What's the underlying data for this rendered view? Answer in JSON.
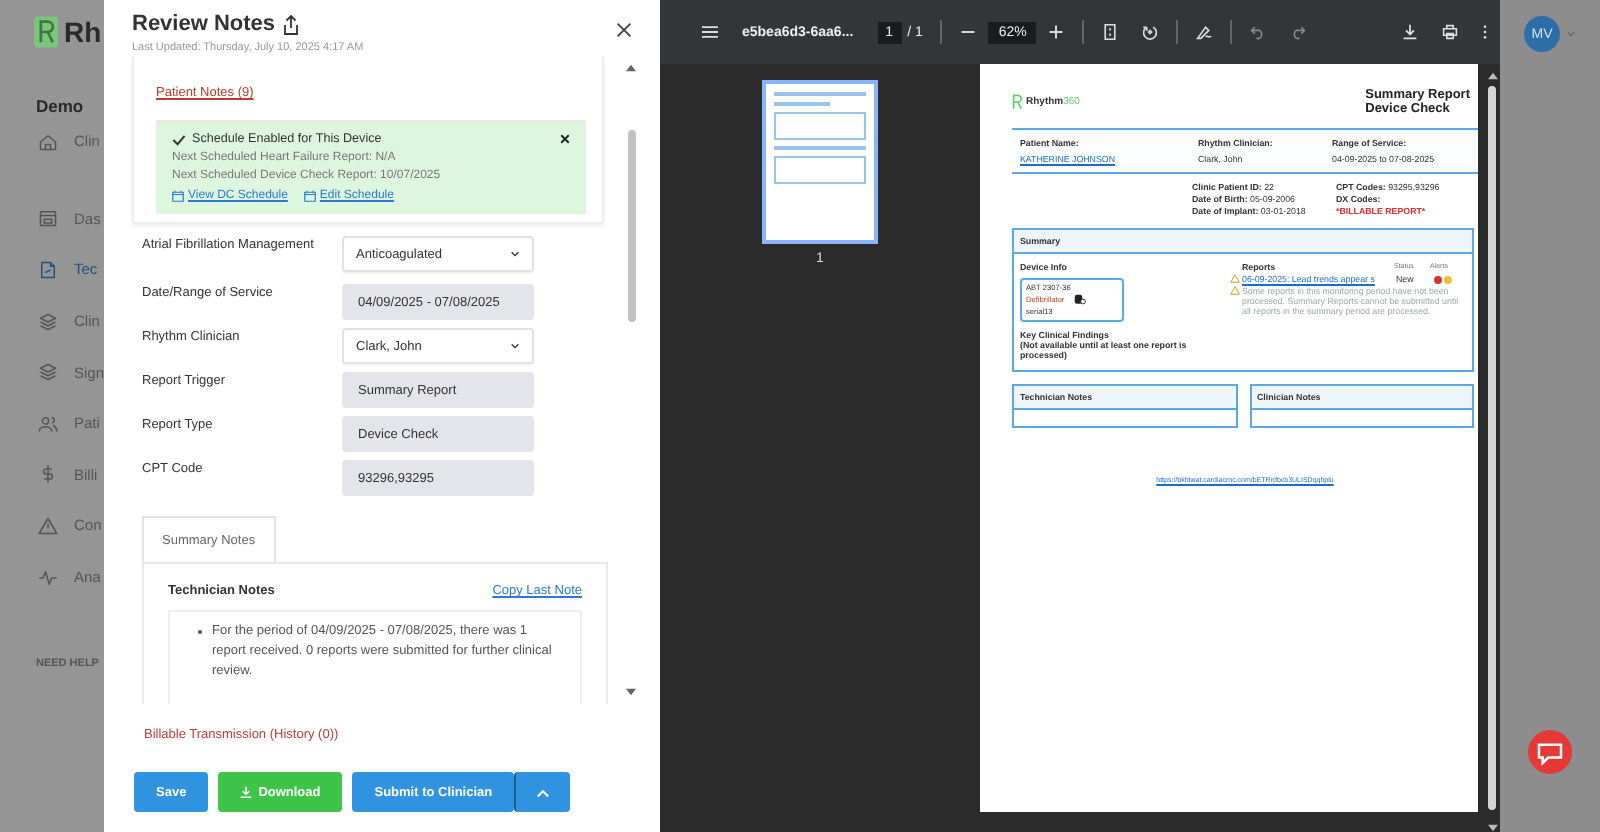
{
  "sidebar": {
    "brand": "Rh",
    "section": "Demo",
    "items": [
      {
        "label": "Clin",
        "selected": false
      },
      {
        "label": "Das",
        "selected": false
      },
      {
        "label": "Tec",
        "selected": true
      },
      {
        "label": "Clin",
        "selected": false
      },
      {
        "label": "Sign",
        "selected": false
      },
      {
        "label": "Pati",
        "selected": false
      },
      {
        "label": "Billi",
        "selected": false
      },
      {
        "label": "Con",
        "selected": false
      },
      {
        "label": "Ana",
        "selected": false
      }
    ],
    "help": "NEED HELP"
  },
  "modal": {
    "title": "Review Notes",
    "updated": "Last Updated: Thursday, July 10, 2025 4:17 AM",
    "patient_notes": "Patient Notes (9)",
    "schedule": {
      "heading": "Schedule Enabled for This Device",
      "lines": [
        "Next Scheduled Heart Failure Report: N/A",
        "Next Scheduled Device Check Report: 10/07/2025"
      ],
      "links": [
        "View DC Schedule",
        "Edit Schedule"
      ]
    },
    "fields": [
      {
        "label": "Atrial Fibrillation Management",
        "kind": "select",
        "value": "Anticoagulated"
      },
      {
        "label": "Date/Range of Service",
        "kind": "readonly",
        "value": "04/09/2025 - 07/08/2025"
      },
      {
        "label": "Rhythm Clinician",
        "kind": "select",
        "value": "Clark, John"
      },
      {
        "label": "Report Trigger",
        "kind": "readonly",
        "value": "Summary Report"
      },
      {
        "label": "Report Type",
        "kind": "readonly",
        "value": "Device Check"
      },
      {
        "label": "CPT Code",
        "kind": "readonly",
        "value": "93296,93295"
      }
    ],
    "tabs": [
      {
        "label": "Summary Notes",
        "selected": true
      }
    ],
    "technician_notes": {
      "title": "Technician Notes",
      "copy_link": "Copy Last Note",
      "bullets": [
        "For the period of 04/09/2025 - 07/08/2025, there was 1 report received. 0 reports were submitted for further clinical review."
      ]
    },
    "billable": "Billable Transmission (History (0))",
    "buttons": [
      {
        "label": "Save",
        "kind": "primary"
      },
      {
        "label": "Download",
        "kind": "download"
      },
      {
        "label": "Submit to Clinician",
        "kind": "primary"
      }
    ]
  },
  "pdf": {
    "filename": "e5bea6d3-6aa6...",
    "page": "1",
    "pages": "/ 1",
    "zoom": "62%",
    "thumbnail_label": "1",
    "report": {
      "brand_name": "Rhythm",
      "brand_suffix": "360",
      "title_lines": [
        "Summary Report",
        "Device Check"
      ],
      "header_fields": [
        {
          "label": "Patient Name:",
          "value": "KATHERINE JOHNSON",
          "link": true
        },
        {
          "label": "Rhythm Clinician:",
          "value": "Clark, John",
          "link": false
        },
        {
          "label": "Range of Service:",
          "value": "04-09-2025 to 07-08-2025",
          "link": false
        }
      ],
      "details_left": [
        "**Clinic Patient ID:** 22",
        "**Date of Birth:** 05-09-2006",
        "**Date of Implant:** 03-01-2018"
      ],
      "details_right": [
        "**CPT Codes:** 93295,93296",
        "**DX Codes:**"
      ],
      "billable": "*BILLABLE REPORT*",
      "summary": {
        "title": "Summary",
        "device_title": "Device Info",
        "device_lines": [
          "ABT 2307-36",
          "Defibrillator",
          "serial13"
        ],
        "reports_title": "Reports",
        "status_title": "Status",
        "alerts_title": "Alerts",
        "report_link": "06-09-2025: Lead trends appear s",
        "report_status": "New",
        "alerts": [
          {
            "color": "#d93030"
          },
          {
            "color": "#f0c030"
          }
        ],
        "warning": "Some reports in this monitoring period have not been processed. Summary Reports cannot be submitted until all reports in the summary period are processed.",
        "findings_title": "Key Clinical Findings",
        "findings_note": "(Not available until at least one report is processed)"
      },
      "notes_boxes": [
        "Technician Notes",
        "Clinician Notes"
      ],
      "url": "https://bkhtwat.cardiacrnc.com/bETRrdbcb3ULISDqqhplu"
    }
  },
  "user": {
    "initials": "MV"
  }
}
